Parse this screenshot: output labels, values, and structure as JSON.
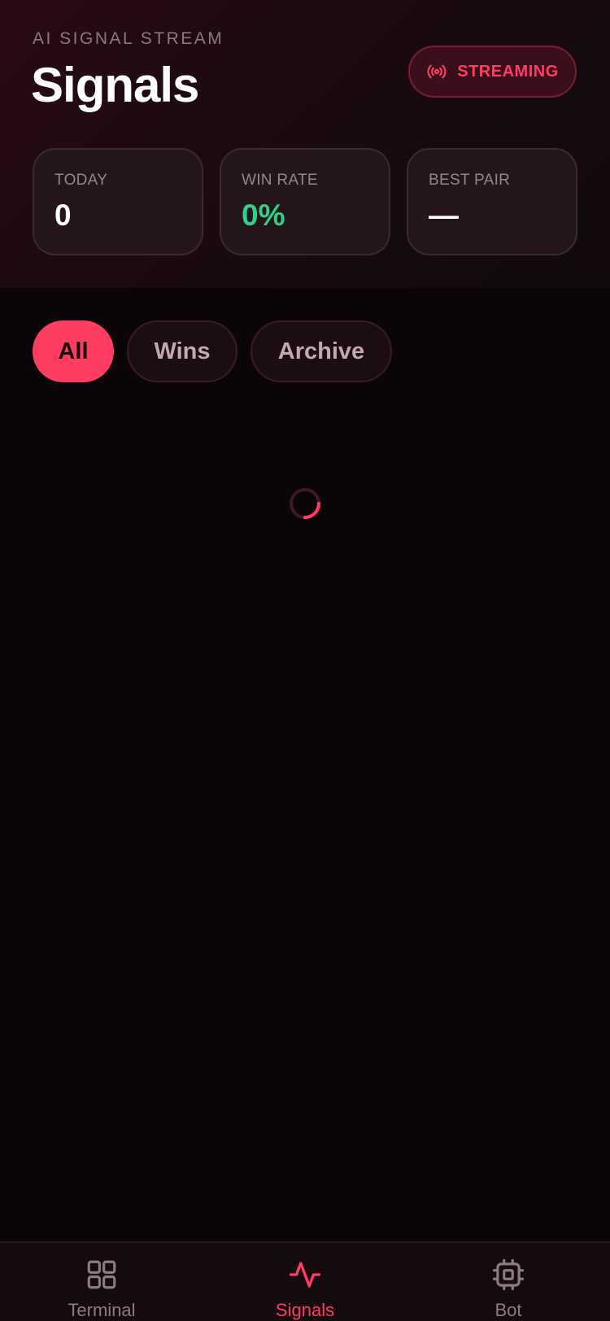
{
  "header": {
    "eyebrow": "AI SIGNAL STREAM",
    "title": "Signals",
    "status_label": "STREAMING"
  },
  "stats": [
    {
      "label": "TODAY",
      "value": "0"
    },
    {
      "label": "WIN RATE",
      "value": "0%"
    },
    {
      "label": "BEST PAIR",
      "value": "—"
    }
  ],
  "filters": [
    {
      "label": "All",
      "selected": true
    },
    {
      "label": "Wins",
      "selected": false
    },
    {
      "label": "Archive",
      "selected": false
    }
  ],
  "loading": true,
  "tabbar": {
    "items": [
      {
        "label": "Terminal",
        "icon": "grid-icon",
        "active": false
      },
      {
        "label": "Signals",
        "icon": "pulse-icon",
        "active": true
      },
      {
        "label": "Bot",
        "icon": "chip-icon",
        "active": false
      }
    ]
  },
  "colors": {
    "accent": "#ff3d63",
    "positive": "#2fd08a",
    "background": "#0c0508"
  }
}
